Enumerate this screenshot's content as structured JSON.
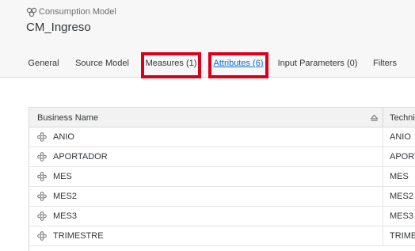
{
  "header": {
    "breadcrumb": "Consumption Model",
    "title": "CM_Ingreso"
  },
  "tabs": [
    {
      "label": "General"
    },
    {
      "label": "Source Model"
    },
    {
      "label": "Measures (1)"
    },
    {
      "label": "Attributes (6)"
    },
    {
      "label": "Input Parameters (0)"
    },
    {
      "label": "Filters"
    }
  ],
  "table": {
    "columns": [
      "Business Name",
      "Technical Name"
    ],
    "rows": [
      {
        "business": "ANIO",
        "technical": "ANIO"
      },
      {
        "business": "APORTADOR",
        "technical": "APORTADOR"
      },
      {
        "business": "MES",
        "technical": "MES"
      },
      {
        "business": "MES2",
        "technical": "MES2"
      },
      {
        "business": "MES3",
        "technical": "MES3"
      },
      {
        "business": "TRIMESTRE",
        "technical": "TRIMESTRE"
      }
    ]
  },
  "colors": {
    "highlight": "#d9001b",
    "active_tab": "#0a6ed1"
  }
}
